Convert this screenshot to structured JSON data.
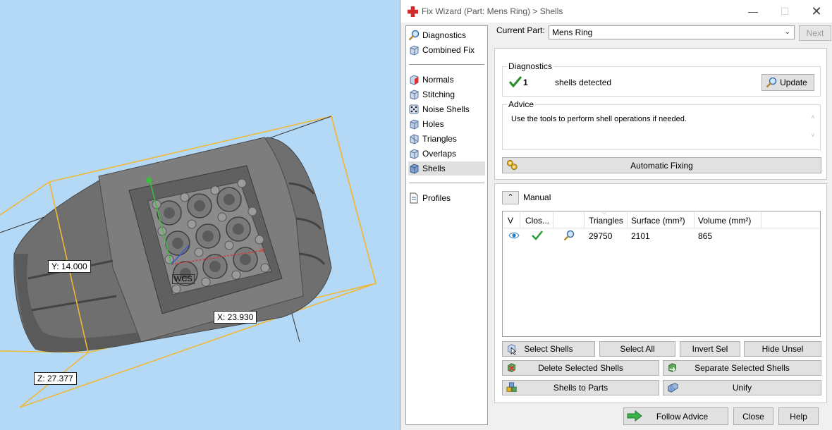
{
  "viewport": {
    "dim_y": "Y: 14.000",
    "dim_x": "X: 23.930",
    "dim_z": "Z: 27.377",
    "wcs": "WCS",
    "axis_x": "x",
    "colors": {
      "background": "#b3d9f7",
      "bbox": "#f0b83a",
      "ring": "#6f6f6f"
    }
  },
  "window": {
    "title": "Fix Wizard (Part: Mens Ring) > Shells",
    "minimize_icon": "minimize-icon",
    "maximize_icon": "maximize-icon",
    "close_icon": "close-icon"
  },
  "nav": {
    "items_top": [
      {
        "label": "Diagnostics",
        "icon": "magnifier-icon"
      },
      {
        "label": "Combined Fix",
        "icon": "cube-icon"
      }
    ],
    "items_mid": [
      {
        "label": "Normals",
        "icon": "cube-red-icon"
      },
      {
        "label": "Stitching",
        "icon": "cube-icon"
      },
      {
        "label": "Noise Shells",
        "icon": "dice-icon"
      },
      {
        "label": "Holes",
        "icon": "cube-icon"
      },
      {
        "label": "Triangles",
        "icon": "triangle-cube-icon"
      },
      {
        "label": "Overlaps",
        "icon": "cube-icon"
      },
      {
        "label": "Shells",
        "icon": "cube-blue-icon"
      }
    ],
    "items_bottom": [
      {
        "label": "Profiles",
        "icon": "document-icon"
      }
    ],
    "selected": "Shells"
  },
  "current_part": {
    "label": "Current Part:",
    "value": "Mens Ring",
    "next_label": "Next"
  },
  "diagnostics": {
    "title": "Diagnostics",
    "count": "1",
    "text": "shells detected",
    "update_label": "Update"
  },
  "advice": {
    "title": "Advice",
    "text": "Use the tools to perform shell operations if needed."
  },
  "automatic_fixing_label": "Automatic Fixing",
  "manual": {
    "label": "Manual",
    "columns": [
      "V",
      "Clos...",
      "",
      "Triangles",
      "Surface (mm²)",
      "Volume (mm²)"
    ],
    "rows": [
      {
        "visible_icon": "eye-icon",
        "closed_icon": "check-icon",
        "tool_icon": "magnifier-icon",
        "triangles": "29750",
        "surface": "2101",
        "volume": "865"
      }
    ]
  },
  "buttons": {
    "select_shells": "Select Shells",
    "select_all": "Select All",
    "invert_sel": "Invert Sel",
    "hide_unsel": "Hide Unsel",
    "delete_selected": "Delete Selected Shells",
    "separate_selected": "Separate Selected Shells",
    "shells_to_parts": "Shells to Parts",
    "unify": "Unify",
    "follow_advice": "Follow Advice",
    "close": "Close",
    "help": "Help"
  }
}
